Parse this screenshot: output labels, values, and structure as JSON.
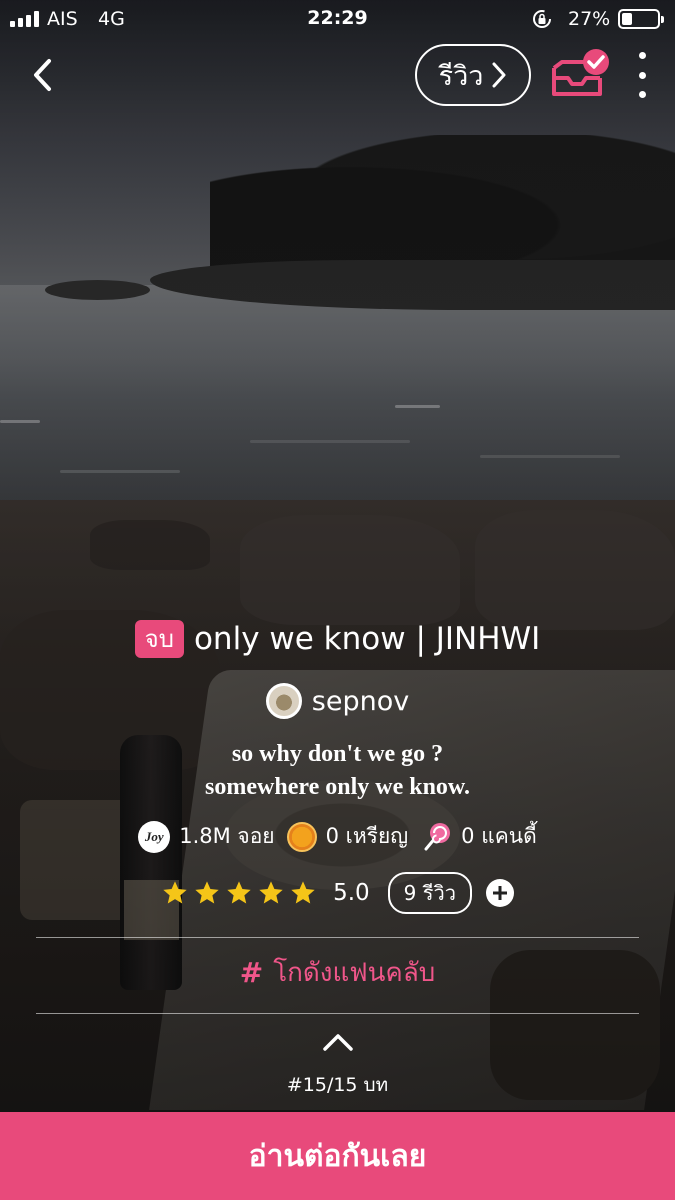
{
  "status_bar": {
    "carrier": "AIS",
    "network": "4G",
    "time": "22:29",
    "battery_percent": "27%",
    "battery_level": 0.27
  },
  "top_nav": {
    "back_icon": "chevron-left-icon",
    "review_label": "รีวิว",
    "inbox_icon": "inbox-check-icon",
    "more_icon": "more-vertical-icon"
  },
  "story": {
    "status_badge": "จบ",
    "title": "only we know | JINHWI",
    "author": "sepnov",
    "tagline_line1": "so why don't we go ?",
    "tagline_line2": "somewhere only we know."
  },
  "stats": {
    "joy_icon_text": "Joy",
    "joy": "1.8M จอย",
    "coins": "0 เหรียญ",
    "candy": "0 แคนดี้"
  },
  "rating": {
    "stars": 5,
    "score": "5.0",
    "review_count": "9 รีวิว"
  },
  "fanclub": {
    "hash_icon": "#",
    "label": "โกดังแฟนคลับ"
  },
  "chapter": {
    "label": "#15/15 บท"
  },
  "cta": {
    "read_label": "อ่านต่อกันเลย"
  },
  "colors": {
    "accent": "#e84a7b",
    "fanclub_text": "#f0568a",
    "star": "#f5c518"
  }
}
